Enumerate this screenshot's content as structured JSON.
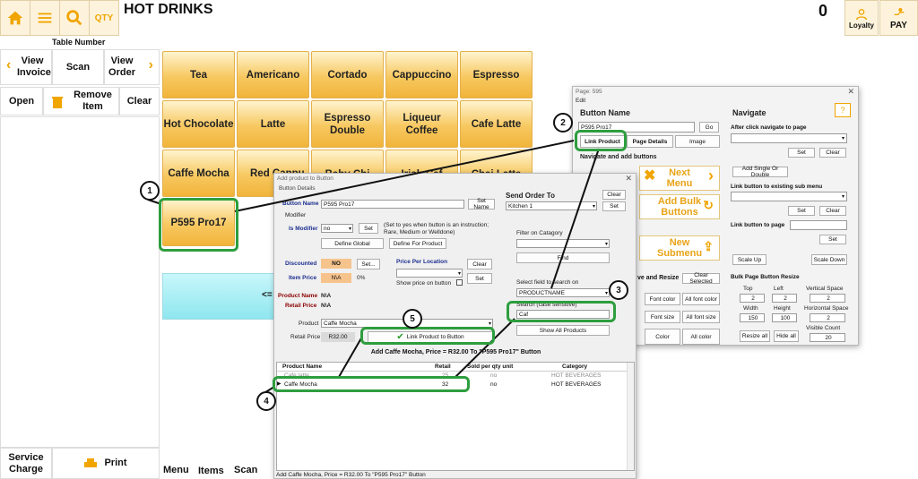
{
  "header": {
    "title": "HOT DRINKS",
    "table_number_label": "Table Number",
    "qty_label": "QTY",
    "total": "0",
    "loyalty_label": "Loyalty",
    "pay_label": "PAY"
  },
  "left_panel": {
    "view_invoice": "View Invoice",
    "scan": "Scan",
    "view_order": "View Order",
    "open": "Open",
    "remove_item": "Remove Item",
    "clear": "Clear",
    "service_charge": "Service Charge",
    "print": "Print"
  },
  "bottom_tabs": [
    "Menu",
    "Items",
    "Scan"
  ],
  "tiles": [
    "Tea",
    "Americano",
    "Cortado",
    "Cappuccino",
    "Espresso",
    "Hot Chocolate",
    "Latte",
    "Espresso Double",
    "Liqueur Coffee",
    "Cafe Latte",
    "Caffe Mocha",
    "Red Cappu",
    "P595 Pro17"
  ],
  "partial_tile_texts": {
    "a": "Baby Chi",
    "b": "Irish Caf",
    "c": "Chai Latte"
  },
  "cyan_strip_text": "<=",
  "page_window": {
    "title": "Page: 595",
    "menu": "Edit",
    "button_name_label": "Button Name",
    "button_name_value": "P595 Pro17",
    "go": "Go",
    "link_product": "Link Product",
    "page_details": "Page Details",
    "image": "Image",
    "navigate_add_buttons": "Navigate and add buttons",
    "next_menu": "Next Menu",
    "add_bulk_buttons": "Add Bulk Buttons",
    "new_submenu": "New Submenu",
    "move_resize": "ve and Resize",
    "clear_selected": "Clear Selected",
    "font_color": "Font color",
    "all_font_color": "All font color",
    "font_size": "Font size",
    "all_font_size": "All font size",
    "color": "Color",
    "all_color": "All color",
    "navigate_title": "Navigate",
    "after_click_label": "After click navigate to page",
    "set": "Set",
    "clear": "Clear",
    "add_single_double": "Add Single Or Double",
    "link_submenu_label": "Link button to existing sub menu",
    "link_page_label": "Link button to page",
    "scale_up": "Scale Up",
    "scale_down": "Scale Down",
    "bulk_resize_title": "Bulk Page Button Resize",
    "top_label": "Top",
    "top_value": "2",
    "left_label": "Left",
    "left_value": "2",
    "vspace_label": "Vertical Space",
    "vspace_value": "2",
    "width_label": "Width",
    "width_value": "150",
    "height_label": "Height",
    "height_value": "100",
    "hspace_label": "Horizontal Space",
    "hspace_value": "2",
    "visible_label": "Visible Count",
    "visible_value": "20",
    "resize_all": "Resize all",
    "hide_all": "Hide all"
  },
  "add_window": {
    "title": "Add product to Button",
    "button_details": "Button Details",
    "button_name_label": "Button Name",
    "button_name_value": "P595 Pro17",
    "set_name": "Set Name",
    "modifier_label": "Modifier",
    "is_modifier_label": "Is Modifier",
    "is_modifier_value": "no",
    "set": "Set",
    "modifier_help": "(Set to yes when button is an instruction; Rare, Medium or Welldone)",
    "define_global": "Define Global",
    "define_for_product": "Define For Product",
    "discounted_label": "Discounted",
    "discounted_value": "NO",
    "set_ellipsis": "Set...",
    "item_price_label": "Item Price",
    "item_price_value": "N\\A",
    "item_price_pct": "0%",
    "price_per_location": "Price Per Location",
    "clear": "Clear",
    "show_price_on_button": "Show price on button",
    "product_name_label": "Product Name",
    "product_name_value": "N\\A",
    "retail_price_label": "Retail Price",
    "retail_price_value": "N\\A",
    "product_label": "Product",
    "product_value": "Caffe Mocha",
    "retail_price2_label": "Retail Price",
    "retail_price2_value": "R32.00",
    "link_product_to_button": "Link Product to Button",
    "send_order_to": "Send Order To",
    "kitchen_value": "Kitchen 1",
    "filter_category": "Filter on Catagory",
    "find": "Find",
    "select_field_label": "Select field to search on",
    "select_field_value": "PRODUCTNAME",
    "search_label": "Search (case sensitive)",
    "search_value": "Caf",
    "show_all_products": "Show All Products",
    "add_line": "Add Caffe Mocha,  Price =   R32.00 To \"P595 Pro17\" Button",
    "status_bar": "Add Caffe Mocha,  Price =  R32.00 To \"P595 Pro17\" Button",
    "table_headers": [
      "Product Name",
      "Retail",
      "Sold per qty unit",
      "Category"
    ],
    "table_rows": [
      [
        "Cafe latte",
        "25",
        "no",
        "HOT BEVERAGES"
      ],
      [
        "Caffe Mocha",
        "32",
        "no",
        "HOT BEVERAGES"
      ]
    ]
  },
  "callouts": [
    "1",
    "2",
    "3",
    "4",
    "5"
  ]
}
